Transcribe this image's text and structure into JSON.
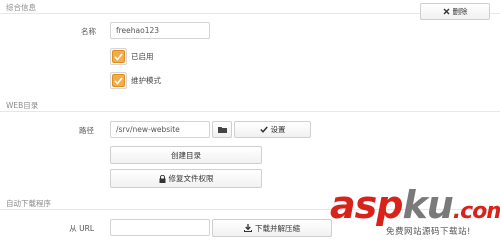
{
  "general": {
    "section_title": "综合信息",
    "delete_label": "删除",
    "name_label": "名称",
    "name_value": "freehao123",
    "enabled_label": "已启用",
    "maintenance_label": "维护模式"
  },
  "web_dir": {
    "section_title": "WEB目录",
    "path_label": "路径",
    "path_value": "/srv/new-website",
    "set_label": "设置",
    "create_dir_label": "创建目录",
    "fix_perms_label": "修复文件权限"
  },
  "auto_download": {
    "section_title": "自动下载程序",
    "from_url_label": "从 URL",
    "url_value": "",
    "download_label": "下载并解压缩"
  },
  "watermark": {
    "brand_red_1": "asp",
    "brand_gray": "ku",
    "brand_red_2": ".com",
    "tagline": "免费网站源码下载站!"
  },
  "colors": {
    "checkbox_accent": "#f0ad4e",
    "watermark_red": "#d8231a"
  },
  "icons": [
    "close-icon",
    "check-icon",
    "folder-icon",
    "lock-icon",
    "download-icon"
  ]
}
